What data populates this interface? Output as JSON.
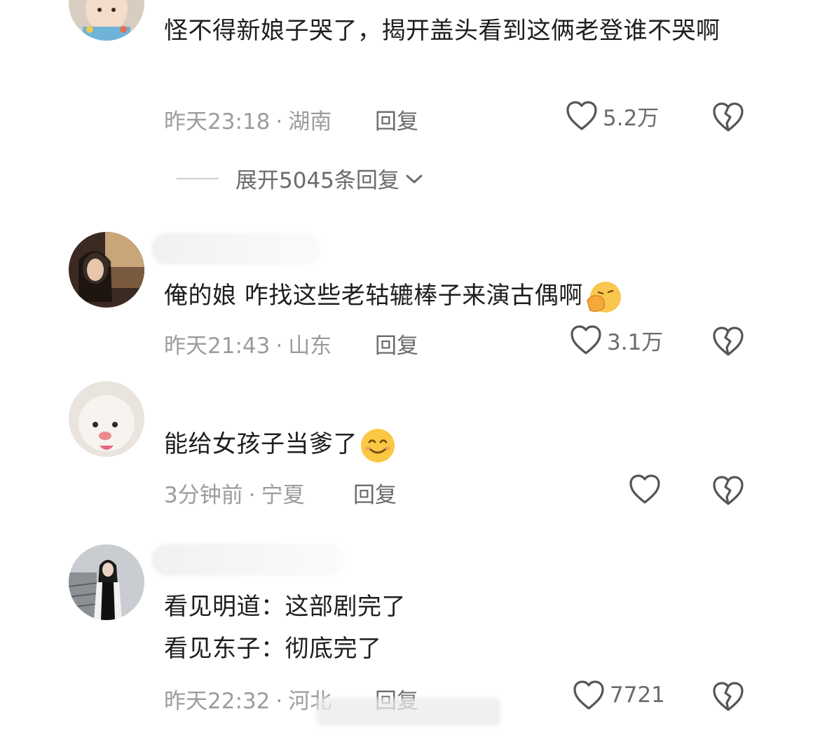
{
  "comments": [
    {
      "text": "怪不得新娘子哭了，揭开盖头看到这俩老登谁不哭啊",
      "time": "昨天23:18",
      "separator": "·",
      "location": "湖南",
      "reply_label": "回复",
      "likes": "5.2万",
      "expand_label": "展开5045条回复"
    },
    {
      "text": "俺的娘 咋找这些老轱辘棒子来演古偶啊",
      "emoji": "face-with-hand-over-mouth",
      "time": "昨天21:43",
      "separator": "·",
      "location": "山东",
      "reply_label": "回复",
      "likes": "3.1万"
    },
    {
      "text": "能给女孩子当爹了",
      "emoji": "smiling-face",
      "time": "3分钟前",
      "separator": "·",
      "location": "宁夏",
      "reply_label": "回复",
      "likes": ""
    },
    {
      "line1": "看见明道：这部剧完了",
      "line2": "看见东子：彻底完了",
      "time": "昨天22:32",
      "separator": "·",
      "location": "河北",
      "reply_label": "回复",
      "likes": "7721"
    }
  ],
  "icons": {
    "like": "heart-outline-icon",
    "dislike": "broken-heart-icon",
    "expand": "chevron-down-icon"
  },
  "colors": {
    "text": "#1e1e1e",
    "meta": "#9c9c9c",
    "action": "#6b6b6b"
  }
}
